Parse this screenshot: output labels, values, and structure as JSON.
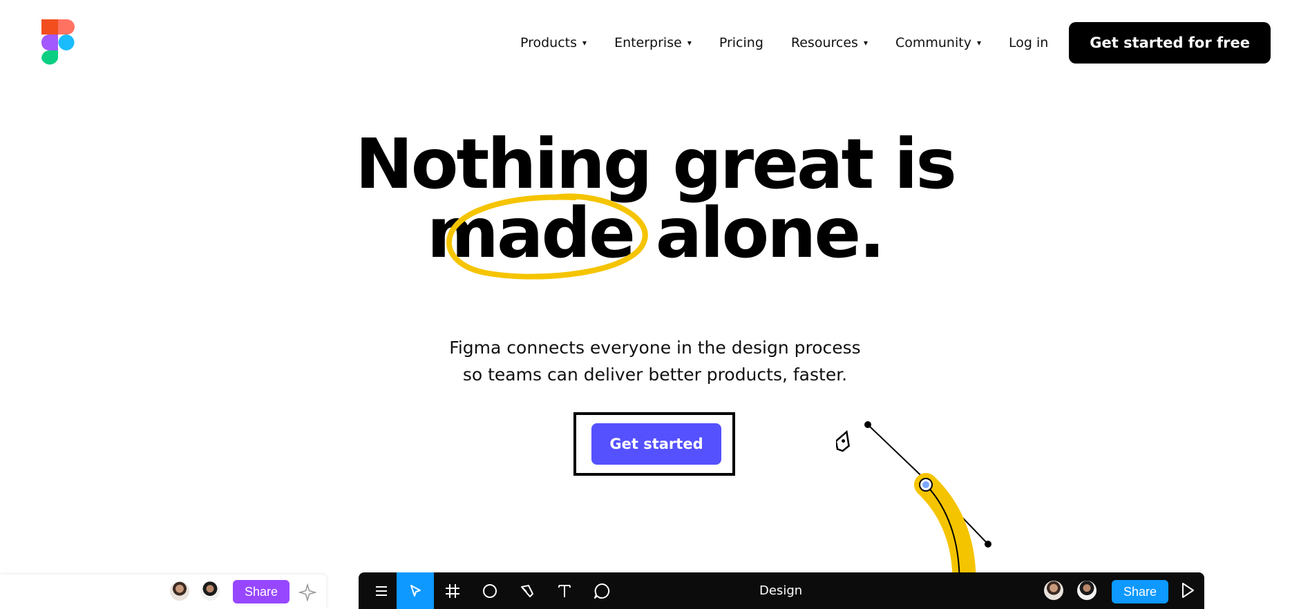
{
  "brand": {
    "logo_icon": "figma-logo-icon",
    "accent": "#5551ff",
    "highlight": "#f5c400"
  },
  "nav": {
    "items": [
      {
        "label": "Products",
        "caret": "▾"
      },
      {
        "label": "Enterprise",
        "caret": "▾"
      },
      {
        "label": "Pricing",
        "caret": ""
      },
      {
        "label": "Resources",
        "caret": "▾"
      },
      {
        "label": "Community",
        "caret": "▾"
      },
      {
        "label": "Log in",
        "caret": ""
      }
    ],
    "cta": "Get started for free"
  },
  "hero": {
    "title_line1": "Nothing great is",
    "title_line2_word": "made",
    "title_line2_rest": " alone.",
    "subtitle_line1": "Figma connects everyone in the design process",
    "subtitle_line2": "so teams can deliver better products, faster.",
    "cta": "Get started"
  },
  "left_panel": {
    "share": "Share",
    "icons": [
      "avatar",
      "avatar",
      "sparkle-icon"
    ]
  },
  "toolbar": {
    "tools": [
      "menu-icon",
      "move-icon",
      "frame-icon",
      "ellipse-icon",
      "pen-icon",
      "text-icon",
      "comment-icon"
    ],
    "active_tool": "move-icon",
    "label": "Design",
    "share": "Share",
    "play_icon": "play-icon"
  }
}
